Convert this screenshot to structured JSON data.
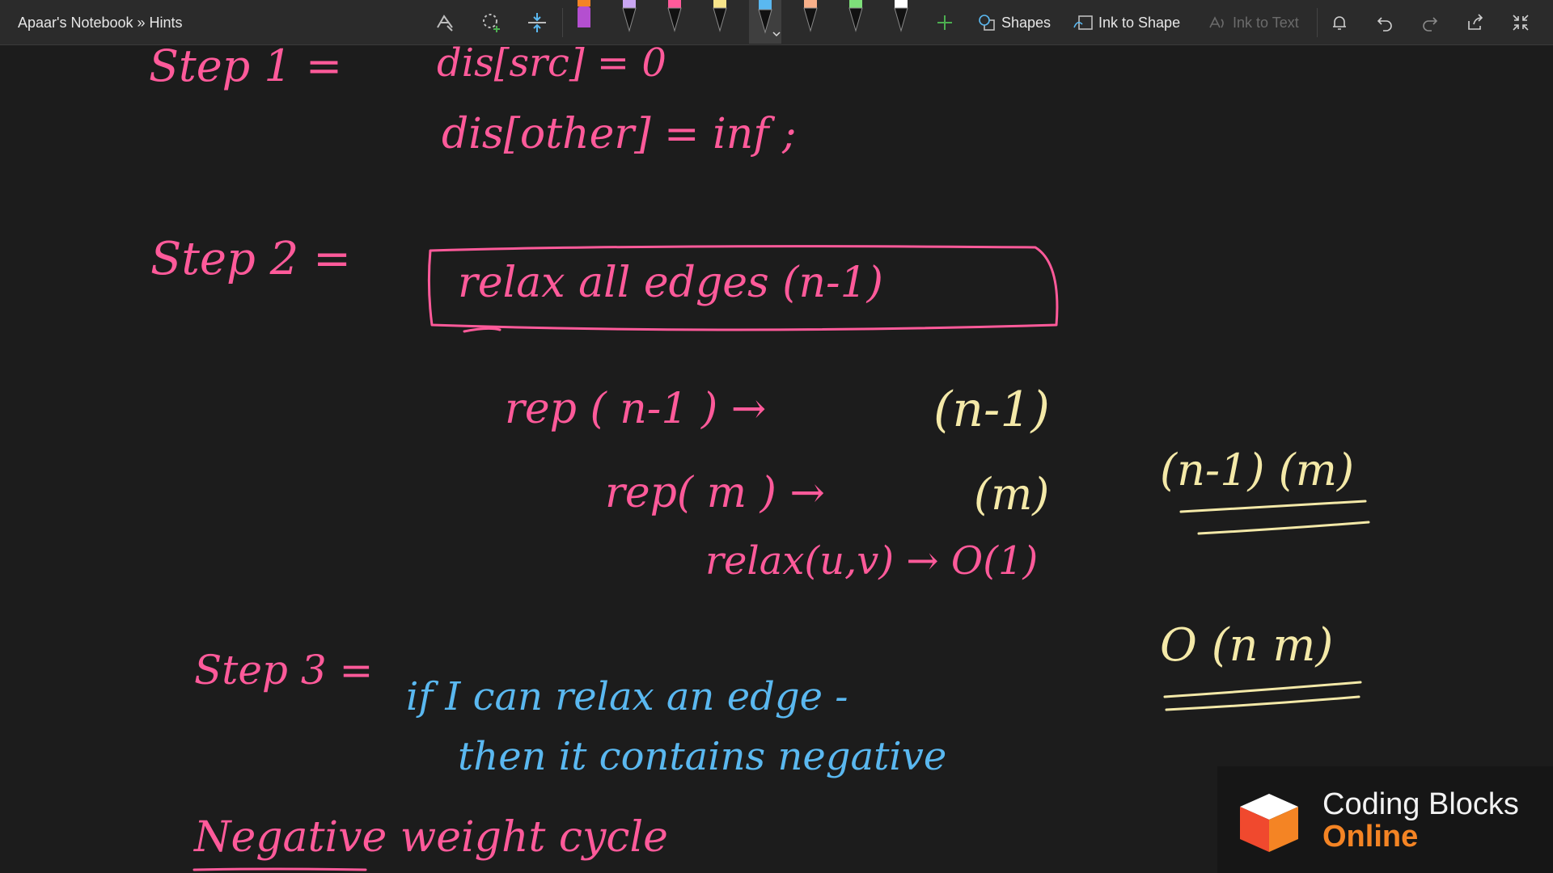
{
  "toolbar": {
    "breadcrumb": "Apaar's Notebook » Hints",
    "shapes_label": "Shapes",
    "ink_to_shape_label": "Ink to Shape",
    "ink_to_text_label": "Ink to Text",
    "pens": [
      {
        "name": "pen-orange-purple",
        "color": "#b44fd0"
      },
      {
        "name": "pen-lavender",
        "color": "#c9a6f2"
      },
      {
        "name": "pen-pink",
        "color": "#ff5a9a"
      },
      {
        "name": "pen-yellow",
        "color": "#f7e48a"
      },
      {
        "name": "pen-blue",
        "color": "#5ab8f0"
      },
      {
        "name": "pen-peach",
        "color": "#f7b08a"
      },
      {
        "name": "pen-green",
        "color": "#7ee07a"
      },
      {
        "name": "pen-white",
        "color": "#ffffff"
      }
    ],
    "icons": [
      "lasso-select-icon",
      "lasso-add-icon",
      "insert-space-icon",
      "add-pen-icon",
      "bell-icon",
      "undo-icon",
      "redo-icon",
      "share-icon",
      "collapse-icon"
    ]
  },
  "notes": {
    "step1_label": "Step 1 =",
    "step1_line1": "dis[src] = 0",
    "step1_line2": "dis[other] = inf ;",
    "step2_label": "Step 2 =",
    "step2_boxed": "relax all edges (n-1)",
    "rep_n1": "rep ( n-1 ) →",
    "rep_n1_result": "(n-1)",
    "rep_m": "rep( m ) →",
    "rep_m_result": "(m)",
    "relax_uv": "relax(u,v) → O(1)",
    "complexity_product": "(n-1) (m)",
    "complexity_big_o": "O (n m)",
    "step3_label": "Step 3 =",
    "step3_line1": "if I can relax an edge -",
    "step3_line2": "then it contains negative",
    "negative_cycle": "Negative weight cycle"
  },
  "brand": {
    "line1": "Coding Blocks",
    "line2": "Online"
  },
  "colors": {
    "pink_ink": "#ff5a9a",
    "yellow_ink": "#f4e9a8",
    "blue_ink": "#5ab8f0",
    "brand_orange": "#f48424",
    "background": "#1c1c1c"
  }
}
